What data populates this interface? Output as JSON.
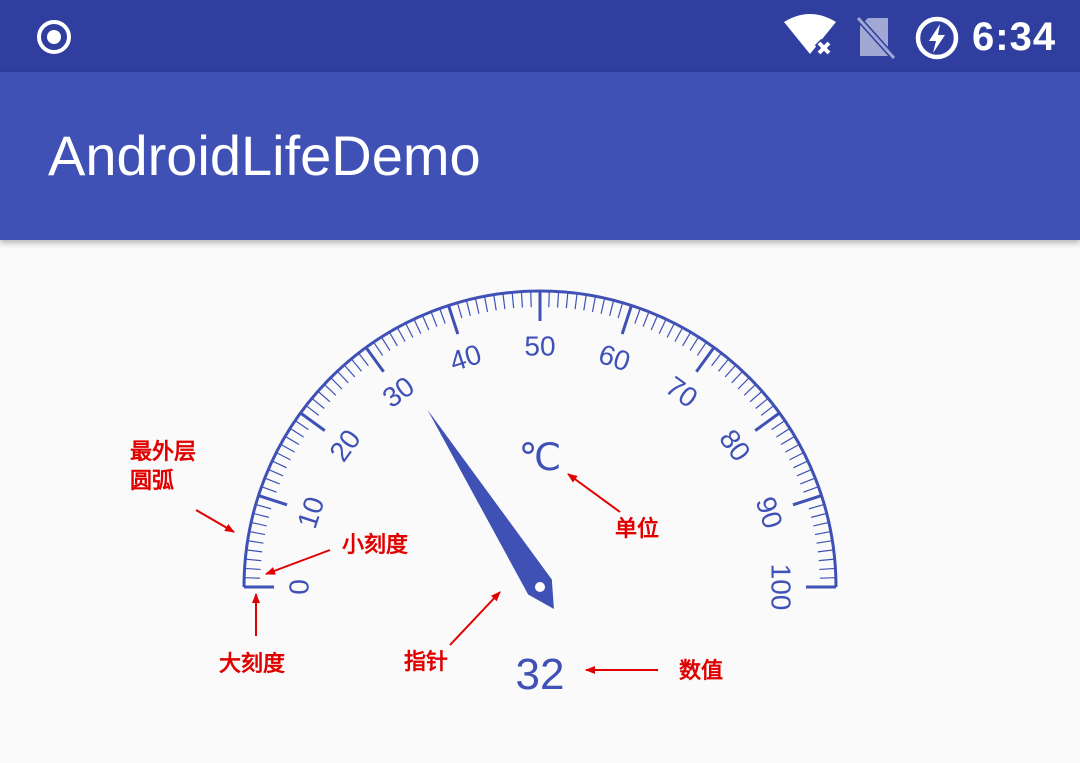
{
  "status_bar": {
    "time": "6:34",
    "icons": [
      "record-icon",
      "wifi-off-icon",
      "no-sim-icon",
      "battery-saver-icon"
    ]
  },
  "app_bar": {
    "title": "AndroidLifeDemo"
  },
  "gauge": {
    "min": 0,
    "max": 100,
    "value": 32,
    "value_text": "32",
    "unit": "℃",
    "start_angle_deg": 180,
    "sweep_angle_deg": 180,
    "major_step": 10,
    "minor_step": 1,
    "major_labels": [
      "0",
      "10",
      "20",
      "30",
      "40",
      "50",
      "60",
      "70",
      "80",
      "90",
      "100"
    ],
    "color": "#3F51B5"
  },
  "annotations": {
    "outer_arc": [
      "最外层",
      "圆弧"
    ],
    "minor_tick": "小刻度",
    "major_tick": "大刻度",
    "pointer": "指针",
    "unit": "单位",
    "value": "数值",
    "color": "#E00000"
  },
  "colors": {
    "status_bar": "#303F9F",
    "app_bar": "#3F51B5",
    "background": "#FAFAFA"
  }
}
